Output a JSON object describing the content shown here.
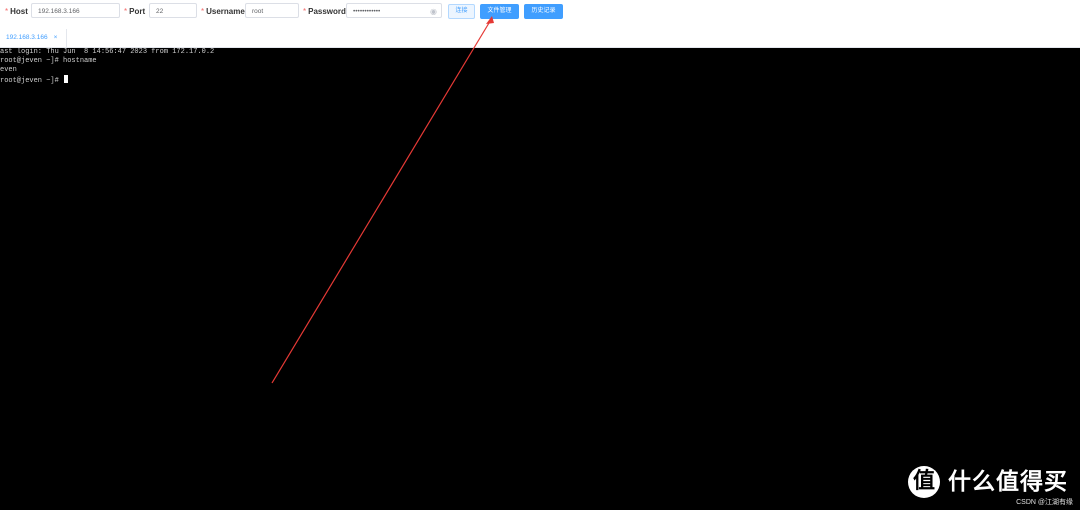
{
  "form": {
    "host_label": "Host",
    "host_value": "192.168.3.166",
    "port_label": "Port",
    "port_value": "22",
    "username_label": "Username",
    "username_value": "root",
    "password_label": "Password",
    "password_value": "••••••••••••",
    "required_mark": "*",
    "password_toggle_icon": "eye-icon"
  },
  "buttons": {
    "connect": "连接",
    "file_manager": "文件管理",
    "history": "历史记录"
  },
  "tabs": [
    {
      "label": "192.168.3.166",
      "close": "×"
    }
  ],
  "terminal": {
    "lines": [
      "ast login: Thu Jun  8 14:56:47 2023 from 172.17.0.2",
      "root@jeven ~]# hostname",
      "even",
      "root@jeven ~]# "
    ]
  },
  "overlay": {
    "logo_mark": "值",
    "logo_text": "什么值得买",
    "watermark": "CSDN @江湖有缘",
    "arrow_color": "#e53935"
  },
  "colors": {
    "accent": "#409eff",
    "terminal_bg": "#000000"
  }
}
